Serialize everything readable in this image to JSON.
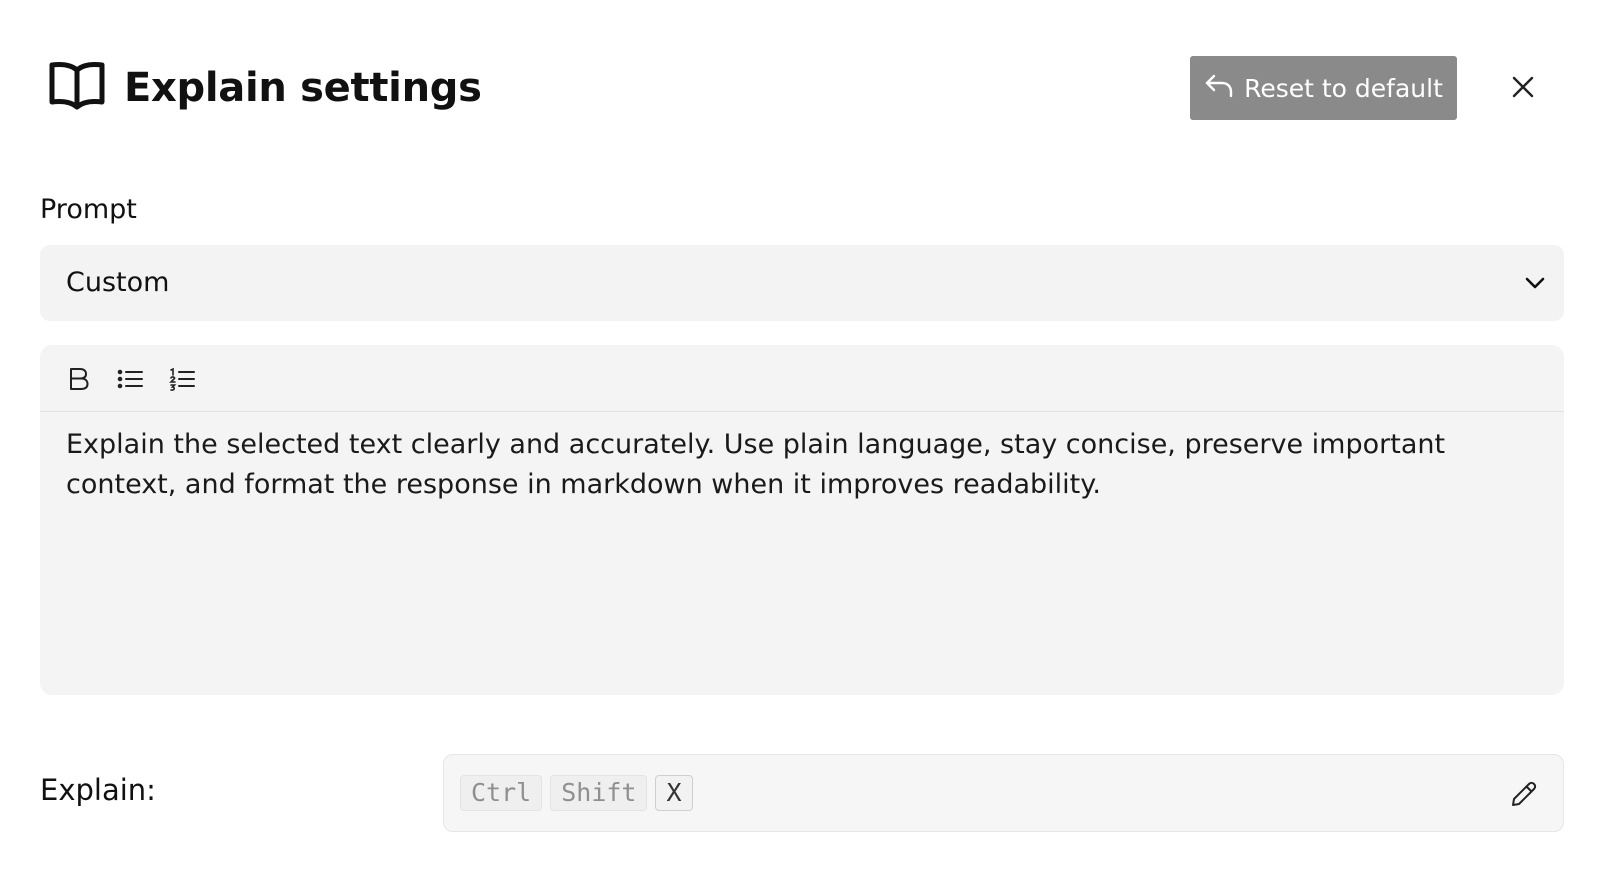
{
  "header": {
    "title": "Explain settings",
    "icon": "book-open-icon",
    "reset_label": "Reset to default",
    "reset_icon": "undo-arrow-icon",
    "close_icon": "close-icon"
  },
  "prompt": {
    "label": "Prompt",
    "selected": "Custom"
  },
  "editor": {
    "toolbar": [
      "bold-icon",
      "bullet-list-icon",
      "numbered-list-icon"
    ],
    "text": "Explain the selected text clearly and accurately. Use plain language, stay concise, preserve important context, and format the response in markdown when it improves readability."
  },
  "shortcut": {
    "label": "Explain:",
    "keys": [
      "Ctrl",
      "Shift",
      "X"
    ],
    "edit_icon": "pencil-icon"
  },
  "colors": {
    "reset_button_bg": "#8a8a8a",
    "field_bg": "#f3f3f3",
    "text": "#111111"
  }
}
